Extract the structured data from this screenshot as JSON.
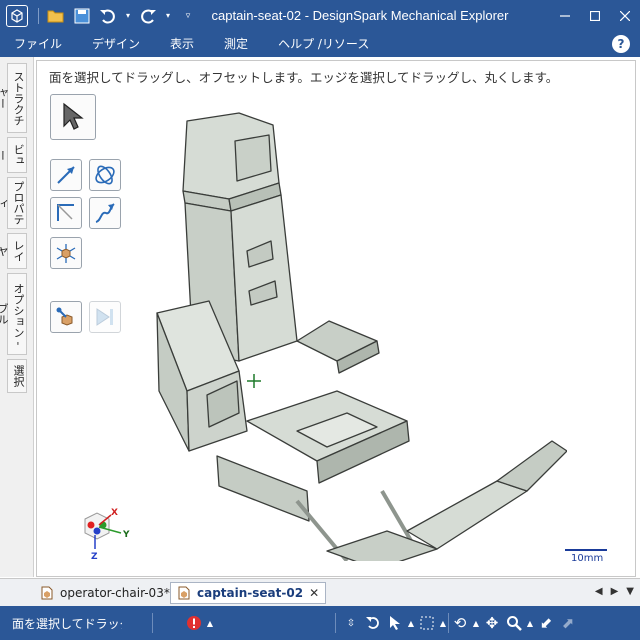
{
  "app": {
    "title": "captain-seat-02 - DesignSpark Mechanical Explorer"
  },
  "menu": {
    "items": [
      "ファイル",
      "デザイン",
      "表示",
      "測定",
      "ヘルプ /リソース"
    ],
    "help": "?"
  },
  "sidetabs": [
    "ストラクチャー",
    "ビュー",
    "プロパティ",
    "レイヤ",
    "オプション - ブル",
    "選択"
  ],
  "viewport": {
    "hint": "面を選択してドラッグし、オフセットします。エッジを選択してドラッグし、丸くします。",
    "scale_label": "10mm",
    "axes": {
      "x": "X",
      "y": "Y",
      "z": "Z"
    }
  },
  "doc_tabs": [
    {
      "label": "operator-chair-03*",
      "active": false
    },
    {
      "label": "captain-seat-02",
      "active": true
    }
  ],
  "status": {
    "text": "面を選択してドラッグし、オフセットします。"
  },
  "colors": {
    "chrome": "#2b5797",
    "seat": "#d6dcd5",
    "outline": "#3a3d3a"
  }
}
